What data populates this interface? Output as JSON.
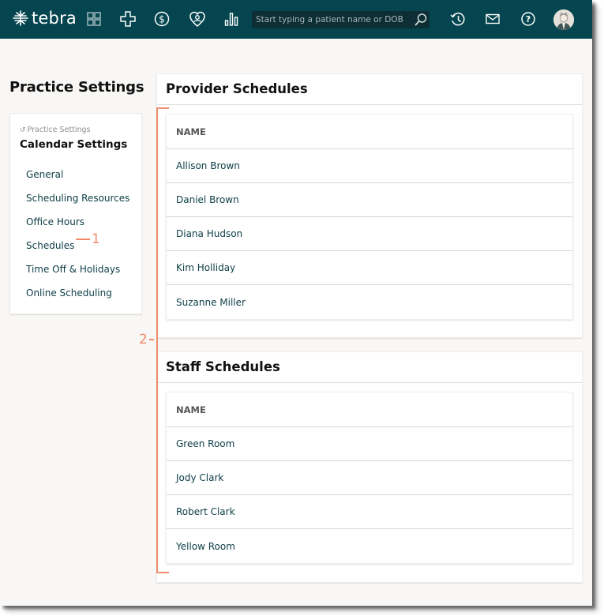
{
  "app": {
    "brand": "tebra",
    "brand_color": "#04454f",
    "accent_color": "#f08a6c"
  },
  "topnav": {
    "icons": [
      "dashboard-grid-icon",
      "clinical-plus-icon",
      "billing-dollar-icon",
      "patient-engagement-heart-icon",
      "reports-bar-chart-icon"
    ],
    "search": {
      "placeholder": "Start typing a patient name or DOB",
      "value": ""
    },
    "right_icons": [
      "history-icon",
      "mail-icon",
      "help-icon",
      "user-avatar"
    ]
  },
  "page": {
    "title": "Practice Settings"
  },
  "sidebar": {
    "back_label": "Practice Settings",
    "subtitle": "Calendar Settings",
    "items": [
      {
        "label": "General"
      },
      {
        "label": "Scheduling Resources"
      },
      {
        "label": "Office Hours"
      },
      {
        "label": "Schedules"
      },
      {
        "label": "Time Off & Holidays"
      },
      {
        "label": "Online Scheduling"
      }
    ]
  },
  "annotations": {
    "callout_1": "1",
    "callout_2": "2"
  },
  "provider_schedules": {
    "title": "Provider Schedules",
    "column_header": "NAME",
    "rows": [
      "Allison Brown",
      "Daniel Brown",
      "Diana Hudson",
      "Kim Holliday",
      "Suzanne Miller"
    ]
  },
  "staff_schedules": {
    "title": "Staff Schedules",
    "column_header": "NAME",
    "rows": [
      "Green Room",
      "Jody Clark",
      "Robert Clark",
      "Yellow Room"
    ]
  }
}
